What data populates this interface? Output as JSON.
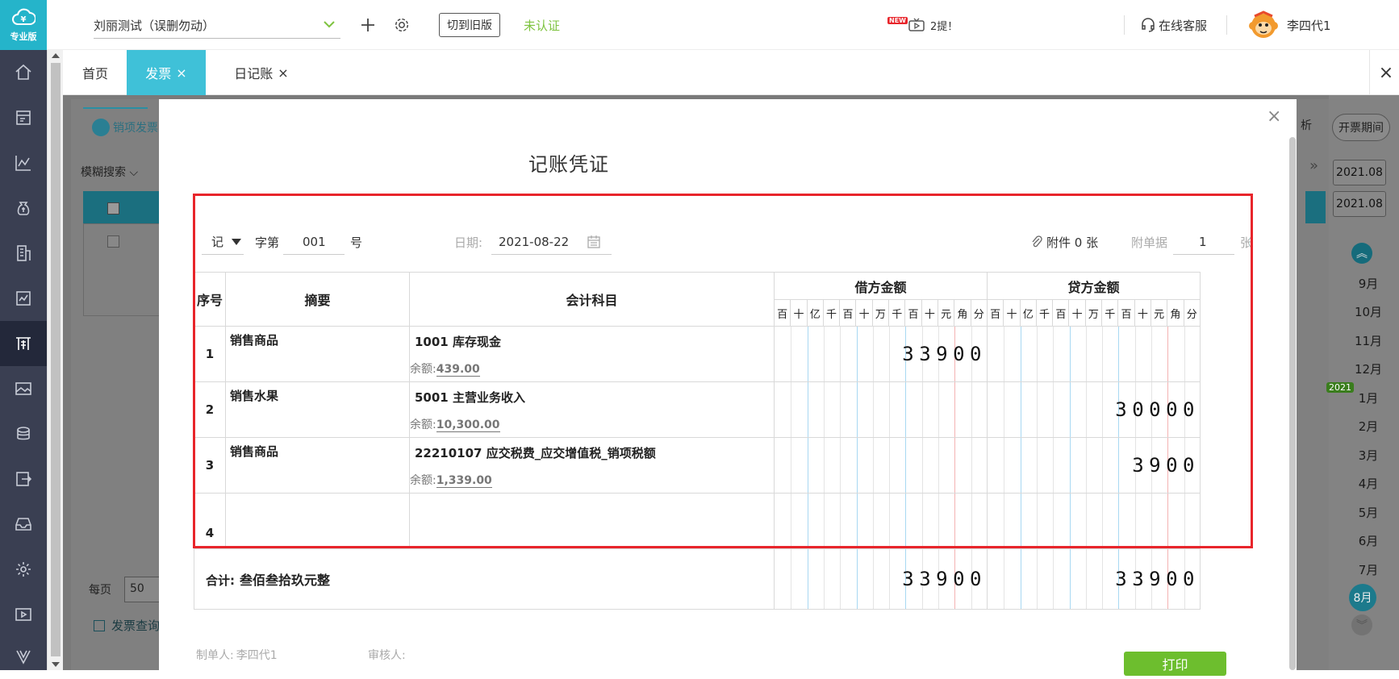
{
  "sidebar": {
    "logo_label": "专业版",
    "icons": [
      "home-icon",
      "invoice-icon",
      "chart-line-icon",
      "money-bag-icon",
      "building-icon",
      "report-icon",
      "voucher-icon",
      "image-icon",
      "coins-icon",
      "export-icon",
      "inbox-icon",
      "gear-icon",
      "video-icon",
      "v-logo-icon"
    ]
  },
  "topbar": {
    "company": "刘丽测试（误删勿动）",
    "switch_button": "切到旧版",
    "auth_status": "未认证",
    "notice_text": "2提！",
    "support": "在线客服",
    "user": "李四代1",
    "new_badge": "NEW",
    "accent": "#3fc1d8",
    "auth_color": "#7ec33f"
  },
  "tabs": [
    {
      "label": "首页"
    },
    {
      "label": "发票"
    },
    {
      "label": "日记账"
    }
  ],
  "background": {
    "section_title": "销项发票",
    "fuzzy_search": "模糊搜索",
    "per_page_label": "每页",
    "per_page_value": "50",
    "invoice_query": "发票查询",
    "invoice_period": "开票期间",
    "period_start": "2021.08",
    "period_end": "2021.08",
    "year_badge": "2021",
    "months": [
      "9月",
      "10月",
      "11月",
      "12月",
      "1月",
      "2月",
      "3月",
      "4月",
      "5月",
      "6月",
      "7月",
      "8月"
    ],
    "partial_label": "析"
  },
  "modal": {
    "title": "记账凭证",
    "voucher_word": "记",
    "word_label": "字第",
    "number": "001",
    "number_suffix": "号",
    "date_label": "日期:",
    "date": "2021-08-22",
    "attachment": "附件 0 张",
    "docs_label": "附单据",
    "docs_count": "1",
    "docs_unit": "张",
    "headers": {
      "seq": "序号",
      "summary": "摘要",
      "account": "会计科目",
      "debit": "借方金额",
      "credit": "贷方金额"
    },
    "digit_units": [
      "百",
      "十",
      "亿",
      "千",
      "百",
      "十",
      "万",
      "千",
      "百",
      "十",
      "元",
      "角",
      "分"
    ],
    "balance_prefix": "余额:",
    "rows": [
      {
        "seq": "1",
        "summary": "销售商品",
        "account": "1001 库存现金",
        "balance": "439.00",
        "debit": "33900",
        "credit": ""
      },
      {
        "seq": "2",
        "summary": "销售水果",
        "account": "5001 主营业务收入",
        "balance": "10,300.00",
        "debit": "",
        "credit": "30000"
      },
      {
        "seq": "3",
        "summary": "销售商品",
        "account": "22210107 应交税费_应交增值税_销项税额",
        "balance": "1,339.00",
        "debit": "",
        "credit": "3900"
      },
      {
        "seq": "4",
        "summary": "",
        "account": "",
        "balance": "",
        "debit": "",
        "credit": ""
      }
    ],
    "total_label": "合计:",
    "total_words": "叁佰叁拾玖元整",
    "total_debit": "33900",
    "total_credit": "33900",
    "maker_label": "制单人:",
    "maker": "李四代1",
    "reviewer_label": "审核人:",
    "print_button": "打印",
    "highlight_color": "#e8252b"
  }
}
